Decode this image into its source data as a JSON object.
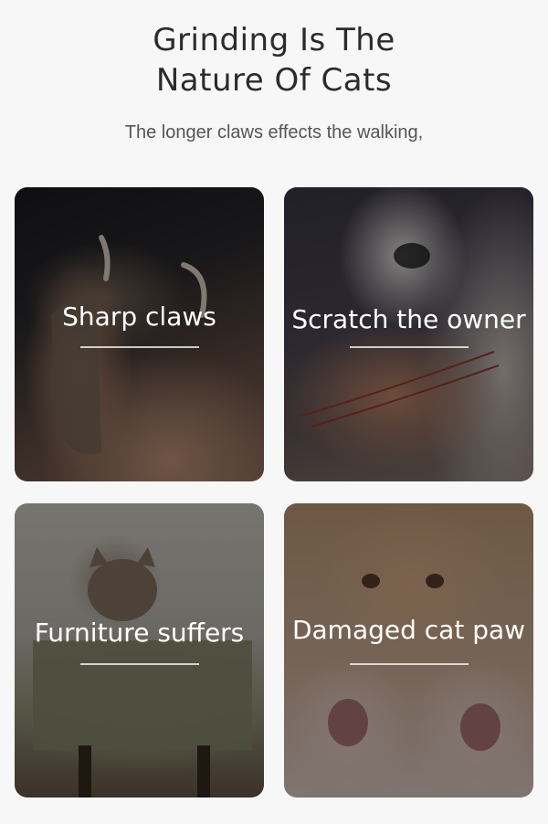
{
  "header": {
    "title_line1": "Grinding Is The",
    "title_line2": "Nature Of Cats",
    "subtitle": "The longer claws effects the walking,"
  },
  "cards": [
    {
      "label": "Sharp claws",
      "image": "cat-claws-photo"
    },
    {
      "label": "Scratch the owner",
      "image": "scratched-arm-photo"
    },
    {
      "label": "Furniture suffers",
      "image": "scratched-chair-photo"
    },
    {
      "label": "Damaged cat paw",
      "image": "kitten-paws-photo"
    }
  ],
  "colors": {
    "background": "#f7f7f7",
    "title": "#2b2b2b",
    "subtitle": "#555555",
    "card_label": "#ffffff"
  }
}
